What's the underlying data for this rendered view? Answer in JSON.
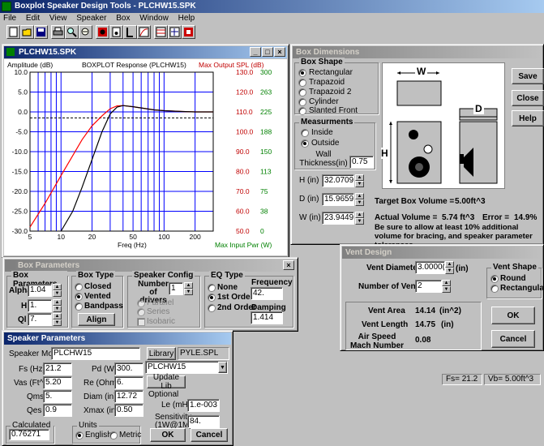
{
  "app": {
    "title": "Boxplot Speaker Design Tools - PLCHW15.SPK",
    "menu": [
      "File",
      "Edit",
      "View",
      "Speaker",
      "Box",
      "Window",
      "Help"
    ],
    "toolbar_icons": [
      "new-file-icon",
      "open-folder-icon",
      "save-disk-icon",
      "print-icon",
      "find-icon",
      "search-icon",
      "speaker-icon",
      "box-icon",
      "vent-icon",
      "graph-icon",
      "crossover-icon",
      "filter-icon",
      "driver-icon"
    ],
    "status": {
      "fs": "Fs= 21.2",
      "vb": "Vb= 5.00ft^3"
    }
  },
  "plot_window": {
    "title": "PLCHW15.SPK",
    "chart_data": {
      "type": "line",
      "title": "BOXPLOT Response (PLCHW15)",
      "ylabel_left": "Amplitude (dB)",
      "ylabel_right": "Max Output SPL (dB)",
      "xlabel": "Freq (Hz)",
      "xlabel_right": "Max Input Pwr (W)",
      "x_scale": "log",
      "xlim": [
        5,
        300
      ],
      "ylim": [
        -30,
        10
      ],
      "grid": true,
      "x_ticks": [
        "5",
        "10",
        "20",
        "50",
        "100",
        "200"
      ],
      "y_ticks_left": [
        "10.0",
        "5.0",
        "0.0",
        "-5.0",
        "-10.0",
        "-15.0",
        "-20.0",
        "-25.0",
        "-30.0"
      ],
      "y_ticks_spl": [
        "130.0",
        "120.0",
        "110.0",
        "100.0",
        "90.0",
        "80.0",
        "70.0",
        "60.0",
        "50.0"
      ],
      "y_ticks_pwr": [
        "300",
        "263",
        "225",
        "188",
        "150",
        "113",
        "75",
        "38",
        "0"
      ],
      "reference_level": -1.5,
      "series": [
        {
          "color": "#ff0000",
          "x": [
            5,
            7,
            10,
            13,
            16,
            20,
            25,
            30,
            35,
            40,
            50,
            60,
            80,
            100,
            150,
            200,
            300
          ],
          "y": [
            -29,
            -23,
            -16,
            -11,
            -7,
            -3.5,
            -1,
            0.8,
            1.5,
            1.6,
            1.3,
            1.0,
            0.5,
            0.3,
            0.1,
            0.0,
            0.0
          ]
        },
        {
          "color": "#000000",
          "x": [
            10,
            13,
            16,
            20,
            25,
            30,
            35,
            40,
            50,
            60,
            80,
            100,
            150,
            200,
            300
          ],
          "y": [
            -30,
            -25,
            -19,
            -12,
            -5,
            -0.5,
            1.2,
            1.6,
            1.3,
            1.0,
            0.5,
            0.3,
            0.1,
            0.0,
            0.0
          ]
        }
      ]
    }
  },
  "box_dimensions": {
    "title": "Box Dimensions",
    "shape_group": "Box Shape",
    "shapes": [
      "Rectangular",
      "Trapazoid",
      "Trapazoid 2",
      "Cylinder",
      "Slanted Front"
    ],
    "selected_shape": "Rectangular",
    "meas_group": "Measurments",
    "meas": [
      "Inside",
      "Outside"
    ],
    "selected_meas": "Outside",
    "wall_label": "Wall Thickness(in)",
    "wall_value": "0.75",
    "h_label": "H (in)",
    "h_value": "32.0709",
    "d_label": "D (in)",
    "d_value": "15.9659",
    "w_label": "W (in)",
    "w_value": "23.9449",
    "diagram_w": "W",
    "diagram_h": "H",
    "diagram_d": "D",
    "target_label": "Target Box Volume =",
    "target_value": "5.00ft^3",
    "actual_label": "Actual Volume =",
    "actual_value": "5.74 ft^3",
    "error_label": "Error =",
    "error_value": "14.9%",
    "note": "Be sure to allow at least 10% additional volume for bracing, and speaker parameter tolerances.",
    "buttons": [
      "Save",
      "Close",
      "Help"
    ]
  },
  "box_params": {
    "title": "Box Parameters",
    "param_group": "Box Parameters",
    "alpha_label": "Alpha",
    "alpha_value": "1.04",
    "h_label": "H",
    "h_value": "1.",
    "ql_label": "Ql",
    "ql_value": "7.",
    "type_group": "Box Type",
    "types": [
      "Closed",
      "Vented",
      "Bandpass"
    ],
    "selected_type": "Vented",
    "align_label": "Align",
    "config_group": "Speaker Config",
    "drivers_label": "Number of drivers",
    "drivers_value": "1",
    "configs": [
      "Parallel",
      "Series"
    ],
    "isobaric_label": "Isobaric",
    "eq_group": "EQ Type",
    "eq_types": [
      "None",
      "1st Order",
      "2nd Order"
    ],
    "selected_eq": "1st Order",
    "freq_label": "Frequency",
    "freq_value": "42.",
    "damping_label": "Damping",
    "damping_value": "1.414"
  },
  "vent": {
    "title": "Vent Design",
    "diameter_label": "Vent Diameter",
    "diameter_value": "3.0000(",
    "diameter_unit": "(in)",
    "num_label": "Number of Vents",
    "num_value": "2",
    "shape_group": "Vent Shape",
    "shapes": [
      "Round",
      "Rectangular"
    ],
    "selected_shape": "Round",
    "area_label": "Vent Area",
    "area_value": "14.14",
    "area_unit": "(in^2)",
    "length_label": "Vent Length",
    "length_value": "14.75",
    "length_unit": "(in)",
    "mach_label": "Air Speed Mach Number",
    "mach_value": "0.08",
    "ok": "OK",
    "cancel": "Cancel"
  },
  "speaker_params": {
    "title": "Speaker Parameters",
    "model_label": "Speaker Model",
    "model_value": "PLCHW15",
    "library_label": "Library",
    "library_value": "PYLE.SPL",
    "select_value": "PLCHW15",
    "update_label": "Update Lib",
    "optional_label": "Optional",
    "fs_label": "Fs (Hz)",
    "fs_value": "21.2",
    "vas_label": "Vas (Ft^3)",
    "vas_value": "5.20",
    "qms_label": "Qms",
    "qms_value": "5.",
    "qes_label": "Qes",
    "qes_value": "0.9",
    "pd_label": "Pd (W)",
    "pd_value": "300.",
    "re_label": "Re (Ohms)",
    "re_value": "6.",
    "diam_label": "Diam (in)",
    "diam_value": "12.72",
    "xmax_label": "Xmax (in)",
    "xmax_value": "0.50",
    "le_label": "Le (mH)",
    "le_value": "1.e-003",
    "sens_label": "Sensitivity (1W@1M)",
    "sens_value": "84.",
    "qts_group": "Calculated Qts",
    "qts_value": "0.76271",
    "units_group": "Units",
    "units": [
      "English",
      "Metric"
    ],
    "selected_unit": "English",
    "ok": "OK",
    "cancel": "Cancel"
  }
}
